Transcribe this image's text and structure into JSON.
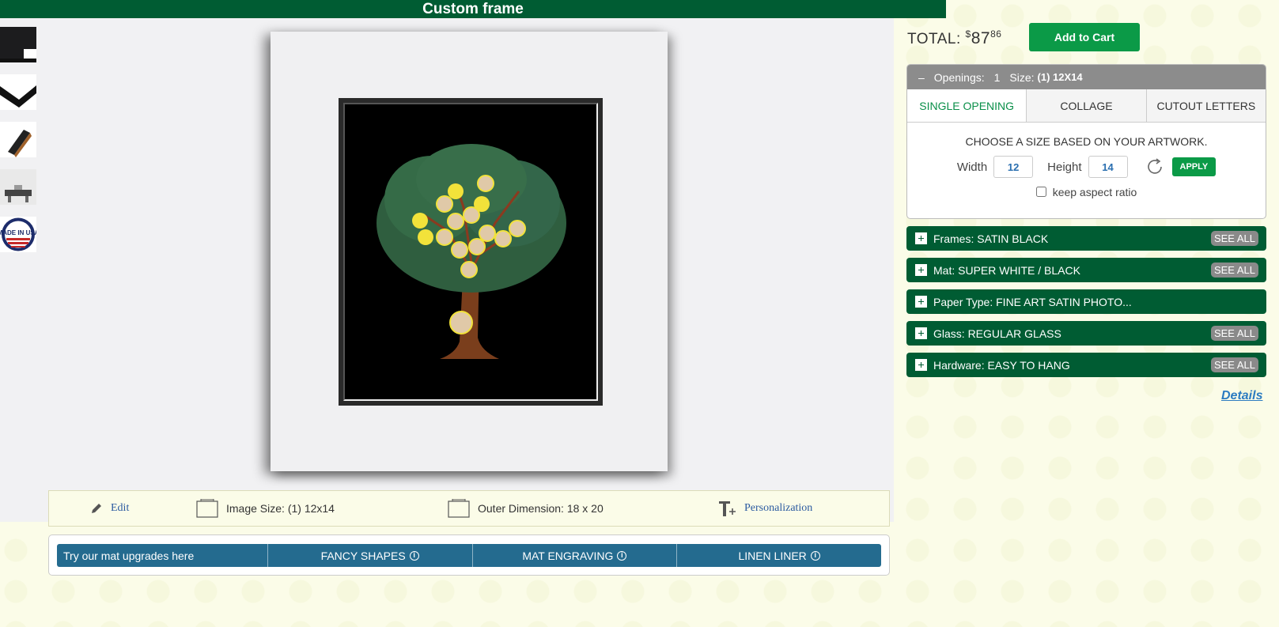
{
  "header": {
    "title": "Custom frame"
  },
  "thumbnails": [
    "frame-corner",
    "frame-profile",
    "frame-side",
    "room-view",
    "made-in-usa"
  ],
  "made_in_usa_text": "MADE IN USA",
  "info_bar": {
    "edit_label": "Edit",
    "image_size_label": "Image Size: (1) 12x14",
    "outer_dimension_label": "Outer Dimension: 18 x 20",
    "personalization_label": "Personalization"
  },
  "upgrades": {
    "lead": "Try our mat upgrades here",
    "items": [
      "FANCY SHAPES",
      "MAT ENGRAVING",
      "LINEN LINER"
    ]
  },
  "cart": {
    "total_label": "TOTAL:",
    "currency": "$",
    "dollars": "87",
    "cents": "86",
    "add_to_cart": "Add to Cart"
  },
  "openings": {
    "collapse_symbol": "–",
    "openings_label": "Openings:",
    "openings_count": "1",
    "size_label": "Size:",
    "size_value": "(1) 12X14",
    "tabs": [
      "SINGLE OPENING",
      "COLLAGE",
      "CUTOUT LETTERS"
    ],
    "instruction": "CHOOSE A SIZE BASED ON YOUR ARTWORK.",
    "width_label": "Width",
    "width_value": "12",
    "height_label": "Height",
    "height_value": "14",
    "apply": "APPLY",
    "aspect_label": "keep aspect ratio"
  },
  "options": [
    {
      "label": "Frames: SATIN BLACK",
      "see_all": "SEE ALL"
    },
    {
      "label": "Mat: SUPER WHITE / BLACK",
      "see_all": "SEE ALL"
    },
    {
      "label": "Paper Type: FINE ART SATIN PHOTO...",
      "see_all": ""
    },
    {
      "label": "Glass: REGULAR GLASS",
      "see_all": "SEE ALL"
    },
    {
      "label": "Hardware: EASY TO HANG",
      "see_all": "SEE ALL"
    }
  ],
  "details_link": "Details",
  "colors": {
    "brand_green": "#005c33",
    "button_green": "#0b9a47",
    "upgrade_blue": "#246b8f",
    "link_blue": "#2d7cc1"
  }
}
